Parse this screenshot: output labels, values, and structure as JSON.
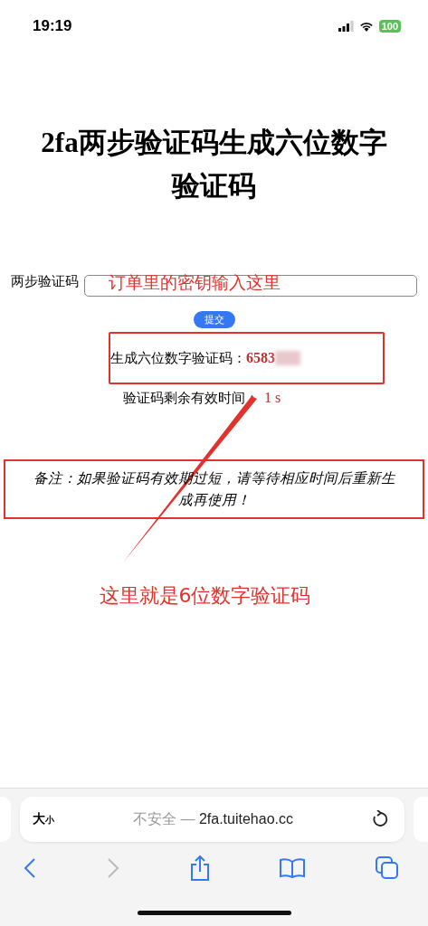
{
  "status_bar": {
    "time": "19:19",
    "battery": "100"
  },
  "title": "2fa两步验证码生成六位数字验证码",
  "form": {
    "label": "两步验证码",
    "annotation": "订单里的密钥输入这里",
    "submit": "提交"
  },
  "result": {
    "label": "生成六位数字验证码：",
    "code": "6583",
    "code_hidden": true
  },
  "timer": {
    "label": "验证码剩余有效时间：",
    "value": "1 s"
  },
  "note": "备注：如果验证码有效期过短，请等待相应时间后重新生成再使用！",
  "annotation": "这里就是6位数字验证码",
  "browser": {
    "text_size_large": "大",
    "text_size_small": "小",
    "security": "不安全 —",
    "url": "2fa.tuitehao.cc"
  }
}
